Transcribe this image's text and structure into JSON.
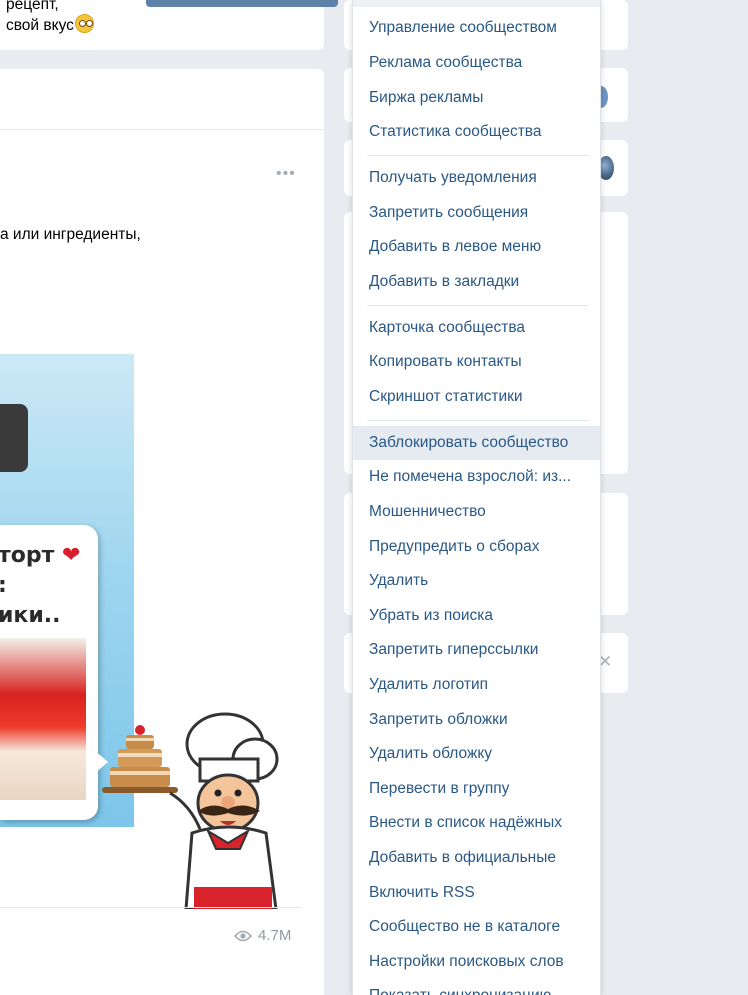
{
  "top_card": {
    "line1": "рецепт,",
    "line2": "свой вкус"
  },
  "post": {
    "text": "а или ингредиенты,",
    "image_text": {
      "line1": "торт",
      "line2": ":",
      "line3": "ики.."
    },
    "views": "4.7M"
  },
  "dropdown": {
    "groups": [
      [
        "Управление сообществом",
        "Реклама сообщества",
        "Биржа рекламы",
        "Статистика сообщества"
      ],
      [
        "Получать уведомления",
        "Запретить сообщения",
        "Добавить в левое меню",
        "Добавить в закладки"
      ],
      [
        "Карточка сообщества",
        "Копировать контакты",
        "Скриншот статистики"
      ],
      [
        "Заблокировать сообщество",
        "Не помечена взрослой: из...",
        "Мошенничество",
        "Предупредить о сборах",
        "Удалить",
        "Убрать из поиска",
        "Запретить гиперссылки",
        "Удалить логотип",
        "Запретить обложки",
        "Удалить обложку",
        "Перевести в группу",
        "Внести в список надёжных",
        "Добавить в официальные",
        "Включить RSS",
        "Сообщество не в каталоге",
        "Настройки поисковых слов",
        "Показать синхронизацию"
      ]
    ],
    "active_item": "Заблокировать сообщество"
  },
  "icons": {
    "post_menu": "more-dots-icon",
    "views": "eye-icon",
    "close": "close-icon"
  },
  "colors": {
    "link": "#2a5885",
    "background": "#e8ebef",
    "active_item_bg": "#e5ebf1"
  }
}
